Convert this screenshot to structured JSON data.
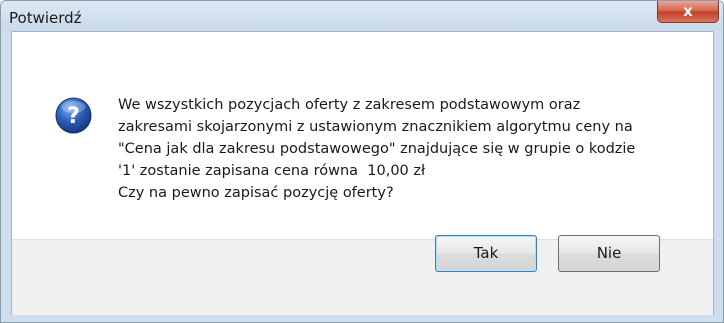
{
  "window": {
    "title": "Potwierdź",
    "close_label": "x"
  },
  "dialog": {
    "icon": "question-icon",
    "message_lines": [
      "We wszystkich pozycjach oferty z zakresem podstawowym oraz",
      "zakresami skojarzonymi z ustawionym znacznikiem algorytmu ceny na",
      "\"Cena jak dla zakresu podstawowego\" znajdujące się w grupie o kodzie",
      "'1' zostanie zapisana cena równa  10,00 zł",
      "Czy na pewno zapisać pozycję oferty?"
    ]
  },
  "buttons": {
    "yes_label": "Tak",
    "no_label": "Nie"
  },
  "colors": {
    "icon_blue": "#2a5db8",
    "close_red": "#c23d24",
    "default_button_border": "#3c7fb1"
  }
}
